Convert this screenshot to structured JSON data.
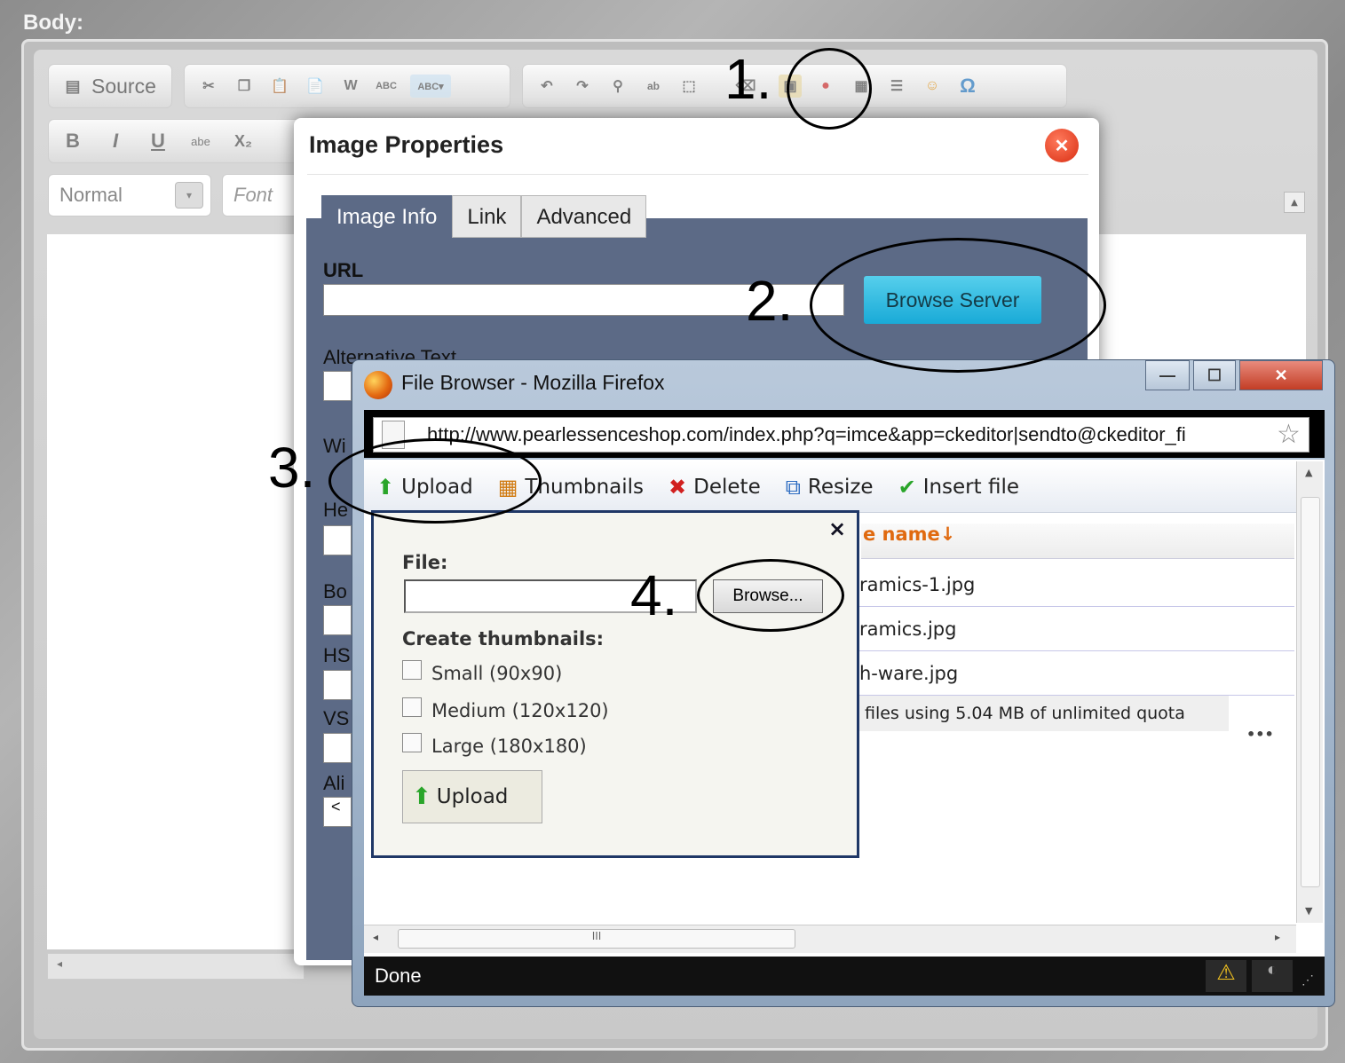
{
  "body_label": "Body:",
  "toolbar": {
    "source_label": "Source",
    "format_value": "Normal",
    "font_placeholder": "Font",
    "icons": [
      "cut-icon",
      "copy-icon",
      "paste-icon",
      "paste-text-icon",
      "paste-word-icon",
      "spellcheck-icon",
      "scayt-icon",
      "undo-icon",
      "redo-icon",
      "find-icon",
      "replace-icon",
      "select-all-icon",
      "remove-format-icon",
      "image-icon",
      "flash-icon",
      "table-icon",
      "horizontal-rule-icon",
      "smiley-icon",
      "special-char-icon"
    ],
    "bold": "B",
    "italic": "I",
    "underline": "U",
    "strike": "abe",
    "subscript": "X₂",
    "omega": "Ω"
  },
  "dialog": {
    "title": "Image Properties",
    "tabs": [
      "Image Info",
      "Link",
      "Advanced"
    ],
    "url_label": "URL",
    "browse_server_label": "Browse Server",
    "alt_label": "Alternative Text",
    "width_label": "Wi",
    "height_label": "He",
    "border_label": "Bo",
    "hspace_label": "HS",
    "vspace_label": "VS",
    "align_label": "Ali",
    "align_value": "<"
  },
  "firefox": {
    "title": "File Browser - Mozilla Firefox",
    "url": "http://www.pearlessenceshop.com/index.php?q=imce&app=ckeditor|sendto@ckeditor_fi",
    "status": "Done"
  },
  "imce": {
    "buttons": [
      {
        "label": "Upload",
        "icon": "upload-icon",
        "glyph": "⬆",
        "color": "#2aa52a"
      },
      {
        "label": "Thumbnails",
        "icon": "thumbnails-icon",
        "glyph": "▦",
        "color": "#d07a10"
      },
      {
        "label": "Delete",
        "icon": "delete-icon",
        "glyph": "✖",
        "color": "#d12020"
      },
      {
        "label": "Resize",
        "icon": "resize-icon",
        "glyph": "⧉",
        "color": "#2a6ac0"
      },
      {
        "label": "Insert file",
        "icon": "insert-file-icon",
        "glyph": "✔",
        "color": "#2aa52a"
      }
    ],
    "column_header": "e name↓",
    "files": [
      "ramics-1.jpg",
      "ramics.jpg",
      "h-ware.jpg"
    ],
    "quota": "files using 5.04 MB of unlimited quota",
    "upload_panel": {
      "file_label": "File:",
      "browse_label": "Browse...",
      "thumbnails_label": "Create thumbnails:",
      "options": [
        "Small (90x90)",
        "Medium (120x120)",
        "Large (180x180)"
      ],
      "upload_label": "Upload",
      "close": "×"
    }
  },
  "steps": [
    "1.",
    "2.",
    "3.",
    "4."
  ]
}
